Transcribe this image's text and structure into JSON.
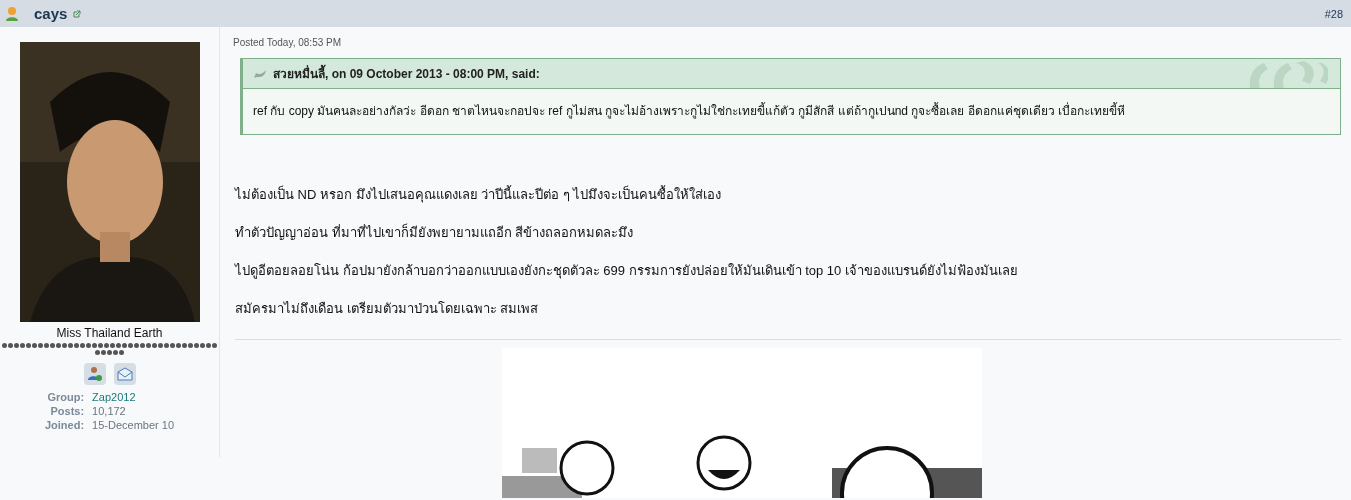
{
  "post_header": {
    "author": "cays",
    "number": "#28"
  },
  "author_panel": {
    "title": "Miss Thailand Earth",
    "stats": [
      {
        "label": "Group:",
        "value": "Zap2012",
        "kind": "link"
      },
      {
        "label": "Posts:",
        "value": "10,172",
        "kind": "text"
      },
      {
        "label": "Joined:",
        "value": "15-December 10",
        "kind": "text"
      }
    ]
  },
  "post": {
    "posted": "Posted Today, 08:53 PM",
    "quote": {
      "citation": "สวยหมื่นลี้, on 09 October 2013 - 08:00 PM, said:",
      "text": "ref กับ copy มันคนละอย่างกัลว่ะ อีดอก ชาตไหนจะกอปจะ ref กูไม่สน กูจะไม่อ้างเพราะกูไม่ใช่กะเทยขี้แก้ตัว กูมีสักสี แต่ถ้ากูเปนnd กูจะซื้อเลย อีดอกแค่ชุดเดียว เบื่อกะเทยขี้หี"
    },
    "paragraphs": [
      "ไม่ต้องเป็น ND หรอก มึงไปเสนอคุณแดงเลย ว่าปีนี้และปีต่อ ๆ ไปมึงจะเป็นคนซื้อให้ใส่เอง",
      "ทำตัวปัญญาอ่อน ที่มาที่ไปเขาก็มียังพยายามแถอีก สีข้างถลอกหมดละมึง",
      "ไปดูอีตอยลอยโน่น ก้อปมายังกล้าบอกว่าออกแบบเองยังกะชุดตัวละ 699 กรรมการยังปล่อยให้มันเดินเข้า top 10 เจ้าของแบรนด์ยังไม่ฟ้องมันเลย",
      "สมัครมาไม่ถึงเดือน เตรียมตัวมาป่วนโดยเฉพาะ สมเพส"
    ]
  }
}
